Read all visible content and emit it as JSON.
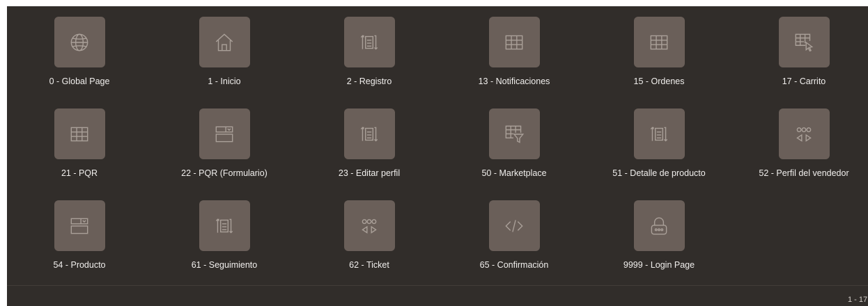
{
  "tiles": [
    {
      "label": "0 - Global Page",
      "icon": "globe-icon"
    },
    {
      "label": "1 - Inicio",
      "icon": "home-icon"
    },
    {
      "label": "2 - Registro",
      "icon": "form-reorder-icon"
    },
    {
      "label": "13 - Notificaciones",
      "icon": "table-icon"
    },
    {
      "label": "15 - Ordenes",
      "icon": "table-icon"
    },
    {
      "label": "17 - Carrito",
      "icon": "table-cursor-icon"
    },
    {
      "label": "21 - PQR",
      "icon": "table-icon"
    },
    {
      "label": "22 - PQR (Formulario)",
      "icon": "form-select-icon"
    },
    {
      "label": "23 - Editar perfil",
      "icon": "form-reorder-icon"
    },
    {
      "label": "50 - Marketplace",
      "icon": "table-filter-icon"
    },
    {
      "label": "51 - Detalle de producto",
      "icon": "form-reorder-icon"
    },
    {
      "label": "52 - Perfil del vendedor",
      "icon": "carousel-icon"
    },
    {
      "label": "54 - Producto",
      "icon": "form-select-icon"
    },
    {
      "label": "61 - Seguimiento",
      "icon": "form-reorder-icon"
    },
    {
      "label": "62 - Ticket",
      "icon": "carousel-icon"
    },
    {
      "label": "65 - Confirmación",
      "icon": "code-icon"
    },
    {
      "label": "9999 - Login Page",
      "icon": "lock-icon"
    }
  ],
  "pagination": {
    "range": "1 - 17"
  },
  "colors": {
    "background": "#312d2a",
    "tile": "#6a5f59",
    "icon_stroke": "#aaa099",
    "text": "#f1efed"
  }
}
